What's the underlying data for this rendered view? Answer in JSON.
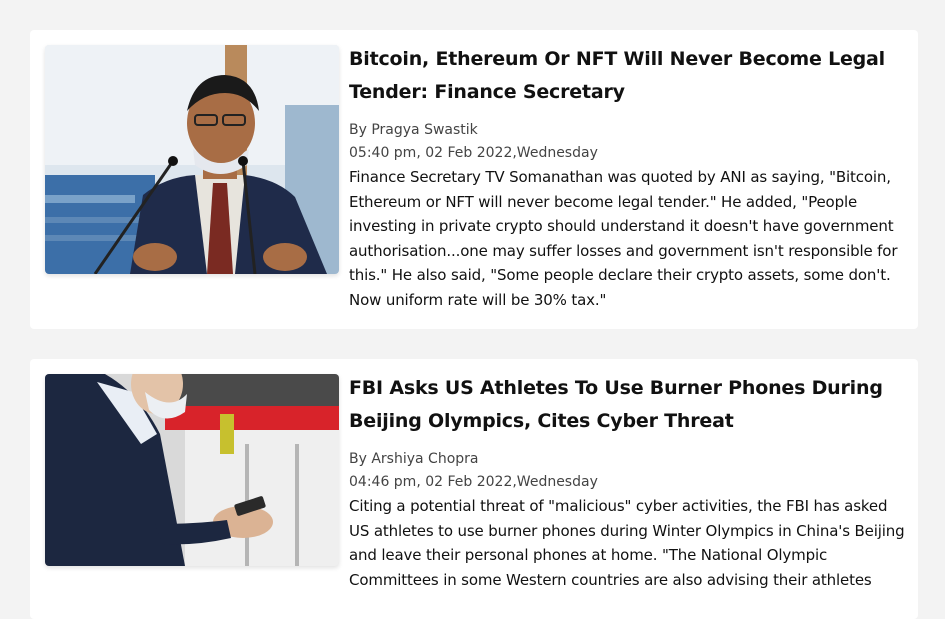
{
  "articles": [
    {
      "title": "Bitcoin, Ethereum Or NFT Will Never Become Legal Tender: Finance Secretary",
      "author": "By Pragya Swastik",
      "datetime": "05:40 pm, 02 Feb 2022,Wednesday",
      "summary": "Finance Secretary TV Somanathan was quoted by ANI as saying, \"Bitcoin, Ethereum or NFT will never become legal tender.\" He added, \"People investing in private crypto should understand it doesn't have government authorisation...one may suffer losses and government isn't responsible for this.\" He also said, \"Some people declare their crypto assets, some don't. Now uniform rate will be 30% tax.\""
    },
    {
      "title": "FBI Asks US Athletes To Use Burner Phones During Beijing Olympics, Cites Cyber Threat",
      "author": "By Arshiya Chopra",
      "datetime": "04:46 pm, 02 Feb 2022,Wednesday",
      "summary": "Citing a potential threat of \"malicious\" cyber activities, the FBI has asked US athletes to use burner phones during Winter Olympics in China's Beijing and leave their personal phones at home. \"The National Olympic Committees in some Western countries are also advising their athletes"
    }
  ],
  "colors": {
    "page_background": "#f3f3f3",
    "card_background": "#ffffff",
    "text_primary": "#111111",
    "text_meta": "#444444"
  },
  "images": {
    "article_1": "man-speaking-at-microphones-photo",
    "article_2": "man-using-smartphone-photo"
  }
}
